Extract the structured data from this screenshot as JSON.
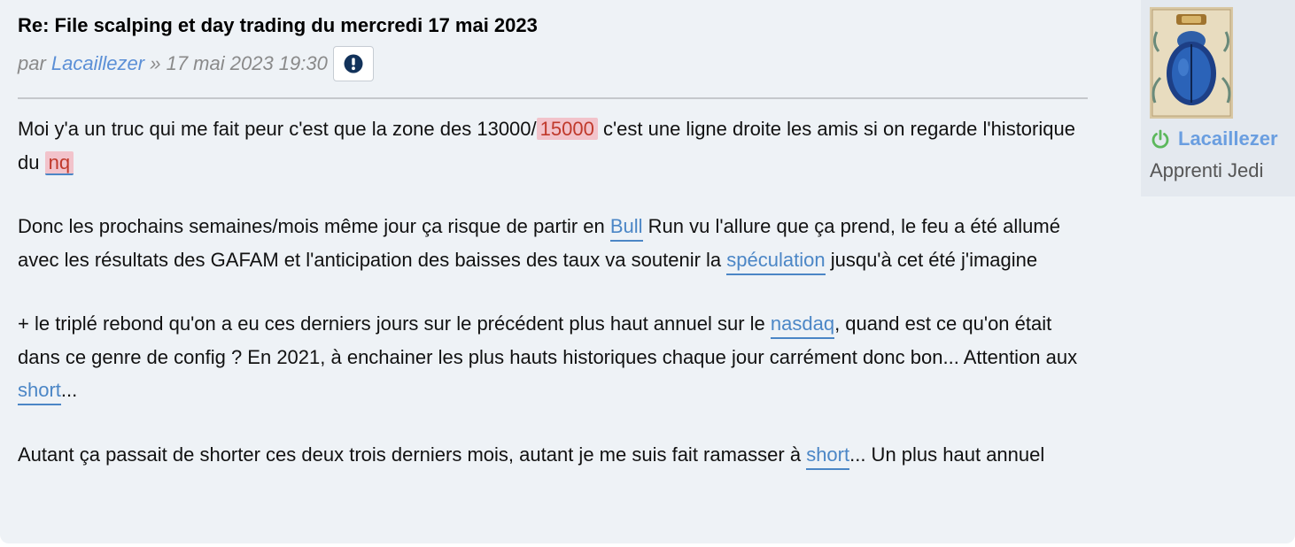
{
  "post": {
    "title": "Re: File scalping et day trading du mercredi 17 mai 2023",
    "by_prefix": "par",
    "author": "Lacaillezer",
    "separator": "»",
    "datetime": "17 mai 2023 19:30",
    "report_icon": "exclamation-circle-icon"
  },
  "content": {
    "p1": {
      "t1": "Moi y'a un truc qui me fait peur c'est que la zone des 13000/",
      "k1": "15000",
      "t2": " c'est une ligne droite les amis si on regarde l'historique du ",
      "k2": "nq"
    },
    "p2": {
      "t1": "Donc les prochains semaines/mois même jour ça risque de partir en ",
      "k1": "Bull",
      "t2": " Run vu l'allure que ça prend, le feu a été allumé avec les résultats des GAFAM et l'anticipation des baisses des taux va soutenir la ",
      "k2": "spéculation",
      "t3": " jusqu'à cet été j'imagine"
    },
    "p3": {
      "t1": "+ le triplé rebond qu'on a eu ces derniers jours sur le précédent plus haut annuel sur le ",
      "k1": "nasdaq",
      "t2": ", quand est ce qu'on était dans ce genre de config ? En 2021, à enchainer les plus hauts historiques chaque jour carrément donc bon... Attention aux ",
      "k2": "short",
      "t3": "..."
    },
    "p4": {
      "t1": "Autant ça passait de shorter ces deux trois derniers mois, autant je me suis fait ramasser à ",
      "k1": "short",
      "t2": "... Un plus haut annuel"
    }
  },
  "profile": {
    "username": "Lacaillezer",
    "rank": "Apprenti Jedi",
    "status_icon": "online-power-icon",
    "colors": {
      "username": "#6a9ee0",
      "online": "#5cb85c"
    }
  },
  "colors": {
    "background": "#eef2f6",
    "keyword_link": "#4b86c6",
    "keyword_highlight_bg": "#f2c3cb",
    "keyword_highlight_text": "#c0392b",
    "author": "#5b8fd6"
  }
}
